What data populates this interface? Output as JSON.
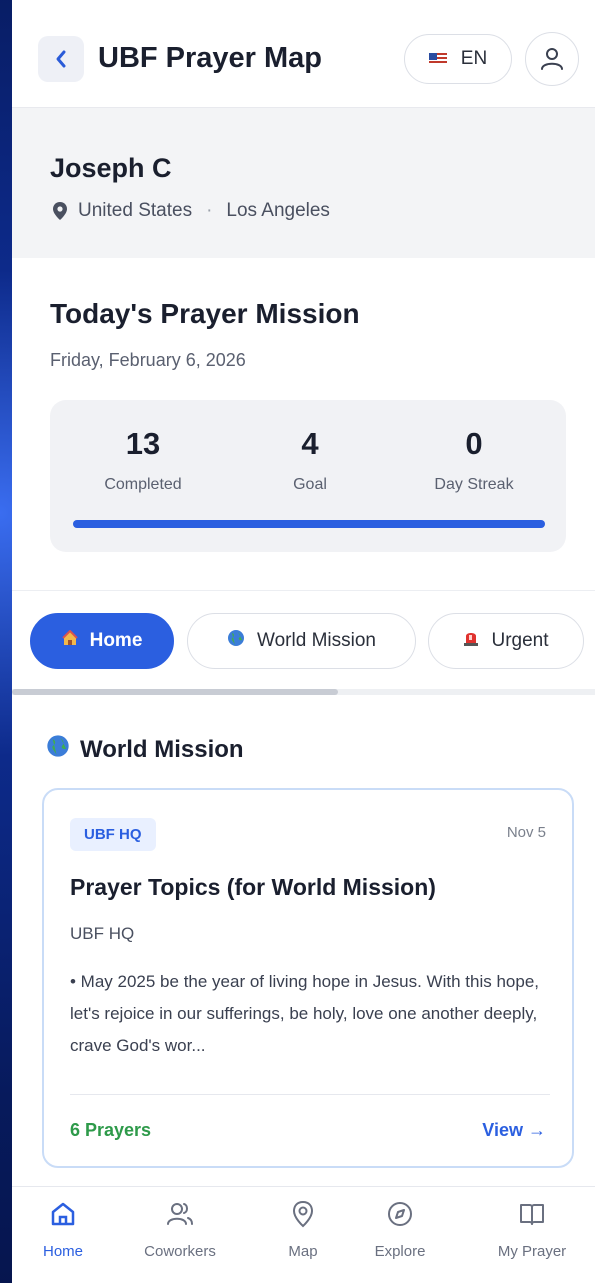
{
  "header": {
    "back_icon": "chevron-left-icon",
    "title": "UBF Prayer Map",
    "language": "EN",
    "flag_icon": "us-flag-icon",
    "user_icon": "user-icon"
  },
  "profile": {
    "name": "Joseph C",
    "location_icon": "map-pin-icon",
    "country": "United States",
    "separator": "·",
    "city": "Los Angeles"
  },
  "mission": {
    "title": "Today's Prayer Mission",
    "date": "Friday, February 6, 2026",
    "stats": [
      {
        "value": "13",
        "label": "Completed"
      },
      {
        "value": "4",
        "label": "Goal"
      },
      {
        "value": "0",
        "label": "Day Streak"
      }
    ],
    "progress_fraction": 1.0
  },
  "tabs": [
    {
      "label": "Home",
      "icon": "house-emoji-icon",
      "active": true
    },
    {
      "label": "World Mission",
      "icon": "globe-emoji-icon",
      "active": false
    },
    {
      "label": "Urgent",
      "icon": "siren-emoji-icon",
      "active": false
    }
  ],
  "feed": {
    "section_title": "World Mission",
    "section_icon": "globe-emoji-icon",
    "card": {
      "badge": "UBF HQ",
      "date": "Nov 5",
      "title": "Prayer Topics (for World Mission)",
      "org": "UBF HQ",
      "body": "• May 2025 be the year of living hope in Jesus. With this hope, let's rejoice in our sufferings, be holy, love one another deeply, crave God's wor...",
      "prayers": "6 Prayers",
      "view": "View →"
    }
  },
  "bottom_nav": [
    {
      "label": "Home",
      "icon": "home-icon",
      "active": true
    },
    {
      "label": "Coworkers",
      "icon": "users-icon",
      "active": false
    },
    {
      "label": "Map",
      "icon": "map-pin-icon",
      "active": false
    },
    {
      "label": "Explore",
      "icon": "compass-icon",
      "active": false
    },
    {
      "label": "My Prayer",
      "icon": "book-icon",
      "active": false
    }
  ],
  "colors": {
    "accent": "#2b5fe0",
    "success": "#2e9a4a",
    "background_outer": "#0a1f6b"
  }
}
